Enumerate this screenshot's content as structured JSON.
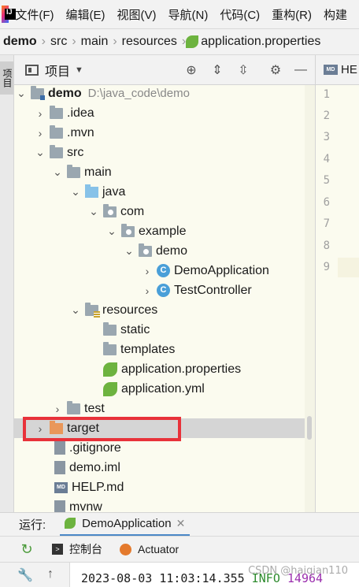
{
  "menu": [
    "文件(F)",
    "编辑(E)",
    "视图(V)",
    "导航(N)",
    "代码(C)",
    "重构(R)",
    "构建"
  ],
  "breadcrumb": [
    "demo",
    "src",
    "main",
    "resources",
    "application.properties"
  ],
  "side_tab": "项目",
  "panel": {
    "title": "项目"
  },
  "editor_tab": {
    "badge": "MD",
    "title": "HE"
  },
  "tree": {
    "root_label": "demo",
    "root_path": "D:\\java_code\\demo",
    "items": [
      ".idea",
      ".mvn",
      "src",
      "main",
      "java",
      "com",
      "example",
      "demo",
      "DemoApplication",
      "TestController",
      "resources",
      "static",
      "templates",
      "application.properties",
      "application.yml",
      "test",
      "target",
      ".gitignore",
      "demo.iml",
      "HELP.md",
      "mvnw"
    ]
  },
  "gutter_lines": [
    "1",
    "2",
    "3",
    "4",
    "5",
    "6",
    "7",
    "8",
    "9"
  ],
  "run": {
    "label": "运行:",
    "config": "DemoApplication"
  },
  "tools": {
    "console": "控制台",
    "actuator": "Actuator"
  },
  "log": {
    "timestamp": "2023-08-03 11:03:14.355",
    "level": "INFO",
    "pid": "14964"
  },
  "watermark": "CSDN @haiqian110"
}
